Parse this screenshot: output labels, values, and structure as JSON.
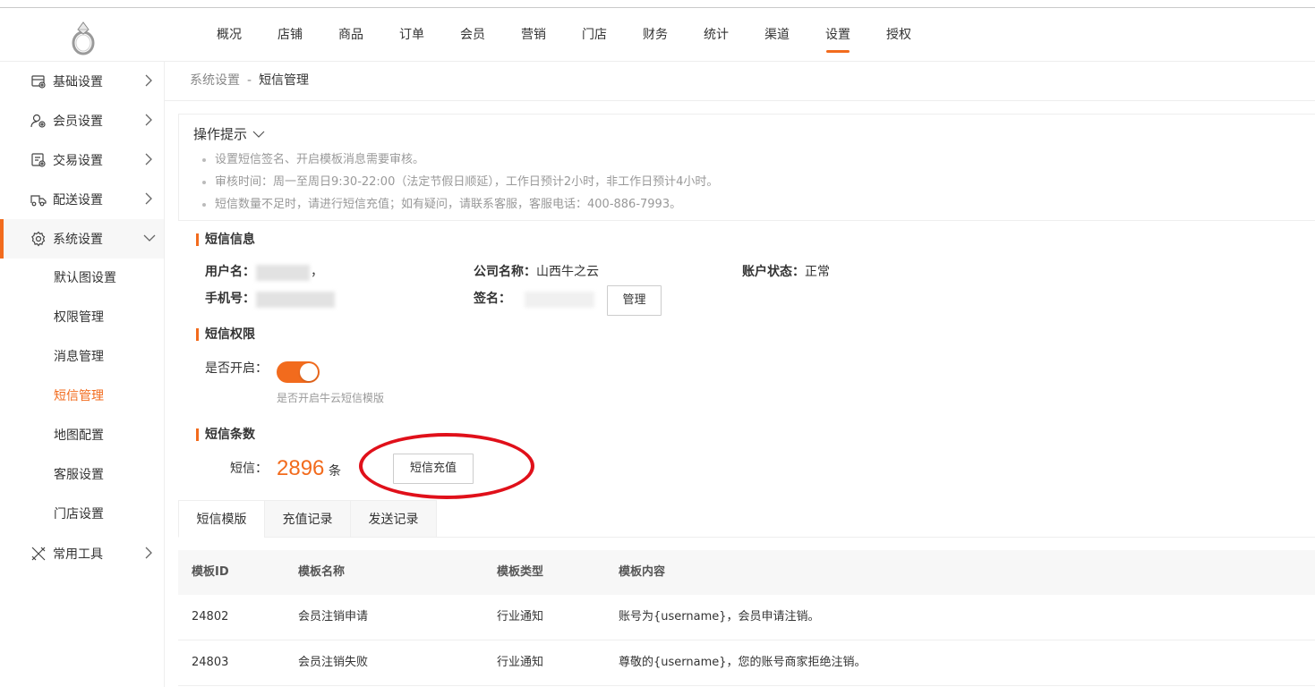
{
  "nav": {
    "items": [
      "概况",
      "店铺",
      "商品",
      "订单",
      "会员",
      "营销",
      "门店",
      "财务",
      "统计",
      "渠道",
      "设置",
      "授权"
    ],
    "active_index": 10
  },
  "sidebar": {
    "items": [
      {
        "label": "基础设置",
        "icon": "store-settings-icon"
      },
      {
        "label": "会员设置",
        "icon": "member-settings-icon"
      },
      {
        "label": "交易设置",
        "icon": "trade-settings-icon"
      },
      {
        "label": "配送设置",
        "icon": "delivery-truck-icon"
      },
      {
        "label": "系统设置",
        "icon": "gear-icon"
      },
      {
        "label": "常用工具",
        "icon": "tools-icon"
      }
    ],
    "subitems": [
      "默认图设置",
      "权限管理",
      "消息管理",
      "短信管理",
      "地图配置",
      "客服设置",
      "门店设置"
    ],
    "active_sub_index": 3
  },
  "breadcrumb": {
    "parent": "系统设置",
    "sep": "-",
    "current": "短信管理"
  },
  "tips": {
    "title": "操作提示",
    "items": [
      "设置短信签名、开启模板消息需要审核。",
      "审核时间：周一至周日9:30-22:00（法定节假日顺延），工作日预计2小时，非工作日预计4小时。",
      "短信数量不足时，请进行短信充值；如有疑问，请联系客服，客服电话：400-886-7993。"
    ]
  },
  "sms_info": {
    "title": "短信信息",
    "username_label": "用户名：",
    "username_suffix": "，",
    "phone_label": "手机号：",
    "company_label": "公司名称：",
    "company_value": "山西牛之云",
    "sign_label": "签名：",
    "manage_button": "管理",
    "status_label": "账户状态：",
    "status_value": "正常"
  },
  "sms_permission": {
    "title": "短信权限",
    "enable_label": "是否开启：",
    "enabled": true,
    "hint": "是否开启牛云短信模版"
  },
  "sms_count": {
    "title": "短信条数",
    "label": "短信：",
    "count": "2896",
    "unit": "条",
    "recharge_button": "短信充值"
  },
  "tabs": [
    "短信模版",
    "充值记录",
    "发送记录"
  ],
  "active_tab": 0,
  "table": {
    "headers": [
      "模板ID",
      "模板名称",
      "模板类型",
      "模板内容"
    ],
    "rows": [
      [
        "24802",
        "会员注销申请",
        "行业通知",
        "账号为{username}，会员申请注销。"
      ],
      [
        "24803",
        "会员注销失败",
        "行业通知",
        "尊敬的{username}，您的账号商家拒绝注销。"
      ]
    ]
  },
  "colors": {
    "accent": "#f26b1d",
    "annotation": "#e0101a"
  }
}
